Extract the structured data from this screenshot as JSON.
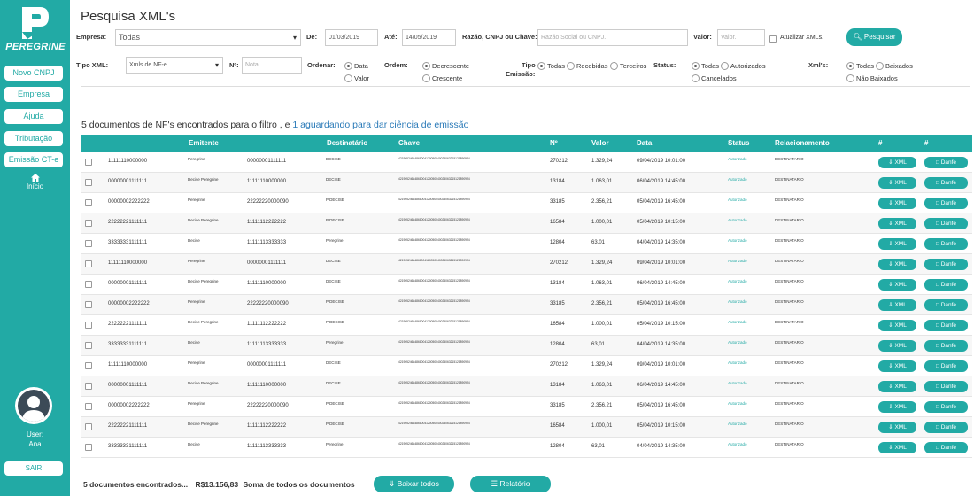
{
  "brand": {
    "name": "PEREGRINE"
  },
  "sidebar": {
    "items": [
      {
        "label": "Novo CNPJ"
      },
      {
        "label": "Empresa"
      },
      {
        "label": "Ajuda"
      },
      {
        "label": "Tributação"
      },
      {
        "label": "Emissão CT-e"
      }
    ],
    "home_label": "Início",
    "user_label": "User:",
    "user_name": "Ana",
    "logout_label": "SAIR"
  },
  "page": {
    "title": "Pesquisa XML's"
  },
  "filters": {
    "empresa_label": "Empresa:",
    "empresa_value": "Todas",
    "de_label": "De:",
    "de_value": "01/03/2019",
    "ate_label": "Até:",
    "ate_value": "14/05/2019",
    "razao_label": "Razão, CNPJ ou Chave:",
    "razao_placeholder": "Razão Social ou CNPJ.",
    "valor_label": "Valor:",
    "valor_placeholder": "Valor.",
    "atualizar_label": "Atualizar XMLs.",
    "search_button": "Pesquisar",
    "tipo_xml_label": "Tipo XML:",
    "tipo_xml_value": "Xmls de NF-e",
    "numero_label": "Nº:",
    "numero_placeholder": "Nota.",
    "ordenar_label": "Ordenar:",
    "ordenar_options": [
      "Data",
      "Valor"
    ],
    "ordem_label": "Ordem:",
    "ordem_options": [
      "Decrescente",
      "Crescente"
    ],
    "tipo_emissao_label_1": "Tipo",
    "tipo_emissao_label_2": "Emissão:",
    "tipo_emissao_options": [
      "Todas",
      "Recebidas",
      "Terceiros"
    ],
    "status_label": "Status:",
    "status_options": [
      "Todas",
      "Autorizados",
      "Cancelados"
    ],
    "xmls_label": "Xml's:",
    "xmls_options": [
      "Todas",
      "Baixados",
      "Não Baixados"
    ]
  },
  "summary": {
    "text": "5 documentos de NF's encontrados para o filtro , e",
    "link": "1 aguardando para dar ciência de emissão"
  },
  "table": {
    "headers": [
      "Emitente",
      "Destinatário",
      "Chave",
      "Nº",
      "Valor",
      "Data",
      "Status",
      "Relacionamento",
      "#",
      "#"
    ],
    "xml_button": "XML",
    "danfe_button": "Danfe",
    "rows": [
      {
        "cnpj_emit": "11111110000000",
        "emit": "Peregrine",
        "cnpj_dest": "00000001111111",
        "dest": "DECISE",
        "chave": "42190524684868004120050040024063215121890954",
        "num": "270212",
        "valor": "1.329,24",
        "data": "09/04/2019 10:01:00",
        "status": "Autorizado",
        "rel": "DESTINATARIO"
      },
      {
        "cnpj_emit": "00000001111111",
        "emit": "Decise Peregrine",
        "cnpj_dest": "11111110000000",
        "dest": "DECISE",
        "chave": "42190524684868004120050040024063215121890954",
        "num": "13184",
        "valor": "1.063,01",
        "data": "06/04/2019 14:45:00",
        "status": "Autorizado",
        "rel": "DESTINATARIO"
      },
      {
        "cnpj_emit": "00000002222222",
        "emit": "Peregrine",
        "cnpj_dest": "22222220000090",
        "dest": "P DECISE",
        "chave": "42190524684868004120050040024063215121890954",
        "num": "33185",
        "valor": "2.356,21",
        "data": "05/04/2019 16:45:00",
        "status": "Autorizado",
        "rel": "DESTINATARIO"
      },
      {
        "cnpj_emit": "22222221111111",
        "emit": "Decise Peregrine",
        "cnpj_dest": "11111112222222",
        "dest": "P DECISE",
        "chave": "42190524684868004120050040024063215121890954",
        "num": "16584",
        "valor": "1.000,01",
        "data": "05/04/2019 10:15:00",
        "status": "Autorizado",
        "rel": "DESTINATARIO"
      },
      {
        "cnpj_emit": "33333331111111",
        "emit": "Decise",
        "cnpj_dest": "11111113333333",
        "dest": "Peregrine",
        "chave": "42190524684868004120050040024063215121890954",
        "num": "12804",
        "valor": "63,01",
        "data": "04/04/2019 14:35:00",
        "status": "Autorizado",
        "rel": "DESTINATARIO"
      },
      {
        "cnpj_emit": "11111110000000",
        "emit": "Peregrine",
        "cnpj_dest": "00000001111111",
        "dest": "DECISE",
        "chave": "42190524684868004120050040024063215121890954",
        "num": "270212",
        "valor": "1.329,24",
        "data": "09/04/2019 10:01:00",
        "status": "Autorizado",
        "rel": "DESTINATARIO"
      },
      {
        "cnpj_emit": "00000001111111",
        "emit": "Decise Peregrine",
        "cnpj_dest": "11111110000000",
        "dest": "DECISE",
        "chave": "42190524684868004120050040024063215121890954",
        "num": "13184",
        "valor": "1.063,01",
        "data": "06/04/2019 14:45:00",
        "status": "Autorizado",
        "rel": "DESTINATARIO"
      },
      {
        "cnpj_emit": "00000002222222",
        "emit": "Peregrine",
        "cnpj_dest": "22222220000090",
        "dest": "P DECISE",
        "chave": "42190524684868004120050040024063215121890954",
        "num": "33185",
        "valor": "2.356,21",
        "data": "05/04/2019 16:45:00",
        "status": "Autorizado",
        "rel": "DESTINATARIO"
      },
      {
        "cnpj_emit": "22222221111111",
        "emit": "Decise Peregrine",
        "cnpj_dest": "11111112222222",
        "dest": "P DECISE",
        "chave": "42190524684868004120050040024063215121890954",
        "num": "16584",
        "valor": "1.000,01",
        "data": "05/04/2019 10:15:00",
        "status": "Autorizado",
        "rel": "DESTINATARIO"
      },
      {
        "cnpj_emit": "33333331111111",
        "emit": "Decise",
        "cnpj_dest": "11111113333333",
        "dest": "Peregrine",
        "chave": "42190524684868004120050040024063215121890954",
        "num": "12804",
        "valor": "63,01",
        "data": "04/04/2019 14:35:00",
        "status": "Autorizado",
        "rel": "DESTINATARIO"
      },
      {
        "cnpj_emit": "11111110000000",
        "emit": "Peregrine",
        "cnpj_dest": "00000001111111",
        "dest": "DECISE",
        "chave": "42190524684868004120050040024063215121890954",
        "num": "270212",
        "valor": "1.329,24",
        "data": "09/04/2019 10:01:00",
        "status": "Autorizado",
        "rel": "DESTINATARIO"
      },
      {
        "cnpj_emit": "00000001111111",
        "emit": "Decise Peregrine",
        "cnpj_dest": "11111110000000",
        "dest": "DECISE",
        "chave": "42190524684868004120050040024063215121890954",
        "num": "13184",
        "valor": "1.063,01",
        "data": "06/04/2019 14:45:00",
        "status": "Autorizado",
        "rel": "DESTINATARIO"
      },
      {
        "cnpj_emit": "00000002222222",
        "emit": "Peregrine",
        "cnpj_dest": "22222220000090",
        "dest": "P DECISE",
        "chave": "42190524684868004120050040024063215121890954",
        "num": "33185",
        "valor": "2.356,21",
        "data": "05/04/2019 16:45:00",
        "status": "Autorizado",
        "rel": "DESTINATARIO"
      },
      {
        "cnpj_emit": "22222221111111",
        "emit": "Decise Peregrine",
        "cnpj_dest": "11111112222222",
        "dest": "P DECISE",
        "chave": "42190524684868004120050040024063215121890954",
        "num": "16584",
        "valor": "1.000,01",
        "data": "05/04/2019 10:15:00",
        "status": "Autorizado",
        "rel": "DESTINATARIO"
      },
      {
        "cnpj_emit": "33333331111111",
        "emit": "Decise",
        "cnpj_dest": "11111113333333",
        "dest": "Peregrine",
        "chave": "42190524684868004120050040024063215121890954",
        "num": "12804",
        "valor": "63,01",
        "data": "04/04/2019 14:35:00",
        "status": "Autorizado",
        "rel": "DESTINATARIO"
      }
    ]
  },
  "footer": {
    "count_text": "5 documentos encontrados...",
    "total_value": "R$13.156,83",
    "total_text": "Soma de todos os documentos",
    "download_button": "Baixar todos",
    "report_button": "Relatório"
  },
  "colors": {
    "accent": "#22aaa5",
    "link": "#2a7ab8"
  }
}
